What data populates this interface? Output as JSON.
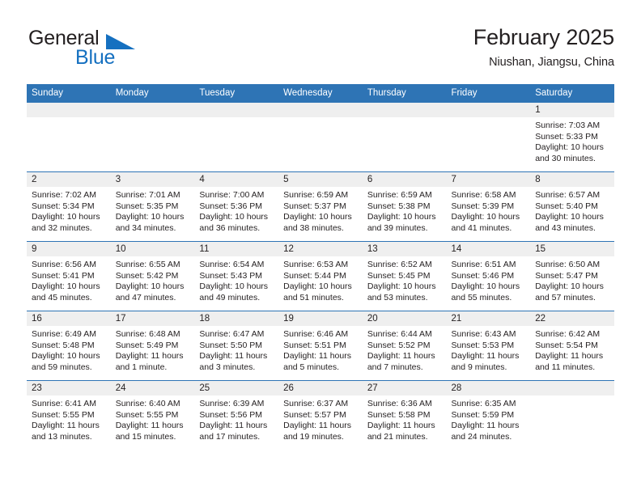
{
  "brand": {
    "name_part1": "General",
    "name_part2": "Blue",
    "triangle_color": "#1570c0",
    "text_color": "#231f20",
    "blue_color": "#1570c0"
  },
  "header": {
    "title": "February 2025",
    "subtitle": "Niushan, Jiangsu, China"
  },
  "theme": {
    "header_blue": "#2e74b5",
    "daynum_band": "#efefef",
    "text": "#231f20"
  },
  "calendar": {
    "weekdays": [
      "Sunday",
      "Monday",
      "Tuesday",
      "Wednesday",
      "Thursday",
      "Friday",
      "Saturday"
    ],
    "weeks": [
      [
        {
          "day": "",
          "sunrise": "",
          "sunset": "",
          "daylight": "",
          "empty": true
        },
        {
          "day": "",
          "sunrise": "",
          "sunset": "",
          "daylight": "",
          "empty": true
        },
        {
          "day": "",
          "sunrise": "",
          "sunset": "",
          "daylight": "",
          "empty": true
        },
        {
          "day": "",
          "sunrise": "",
          "sunset": "",
          "daylight": "",
          "empty": true
        },
        {
          "day": "",
          "sunrise": "",
          "sunset": "",
          "daylight": "",
          "empty": true
        },
        {
          "day": "",
          "sunrise": "",
          "sunset": "",
          "daylight": "",
          "empty": true
        },
        {
          "day": "1",
          "sunrise": "Sunrise: 7:03 AM",
          "sunset": "Sunset: 5:33 PM",
          "daylight": "Daylight: 10 hours and 30 minutes.",
          "empty": false
        }
      ],
      [
        {
          "day": "2",
          "sunrise": "Sunrise: 7:02 AM",
          "sunset": "Sunset: 5:34 PM",
          "daylight": "Daylight: 10 hours and 32 minutes.",
          "empty": false
        },
        {
          "day": "3",
          "sunrise": "Sunrise: 7:01 AM",
          "sunset": "Sunset: 5:35 PM",
          "daylight": "Daylight: 10 hours and 34 minutes.",
          "empty": false
        },
        {
          "day": "4",
          "sunrise": "Sunrise: 7:00 AM",
          "sunset": "Sunset: 5:36 PM",
          "daylight": "Daylight: 10 hours and 36 minutes.",
          "empty": false
        },
        {
          "day": "5",
          "sunrise": "Sunrise: 6:59 AM",
          "sunset": "Sunset: 5:37 PM",
          "daylight": "Daylight: 10 hours and 38 minutes.",
          "empty": false
        },
        {
          "day": "6",
          "sunrise": "Sunrise: 6:59 AM",
          "sunset": "Sunset: 5:38 PM",
          "daylight": "Daylight: 10 hours and 39 minutes.",
          "empty": false
        },
        {
          "day": "7",
          "sunrise": "Sunrise: 6:58 AM",
          "sunset": "Sunset: 5:39 PM",
          "daylight": "Daylight: 10 hours and 41 minutes.",
          "empty": false
        },
        {
          "day": "8",
          "sunrise": "Sunrise: 6:57 AM",
          "sunset": "Sunset: 5:40 PM",
          "daylight": "Daylight: 10 hours and 43 minutes.",
          "empty": false
        }
      ],
      [
        {
          "day": "9",
          "sunrise": "Sunrise: 6:56 AM",
          "sunset": "Sunset: 5:41 PM",
          "daylight": "Daylight: 10 hours and 45 minutes.",
          "empty": false
        },
        {
          "day": "10",
          "sunrise": "Sunrise: 6:55 AM",
          "sunset": "Sunset: 5:42 PM",
          "daylight": "Daylight: 10 hours and 47 minutes.",
          "empty": false
        },
        {
          "day": "11",
          "sunrise": "Sunrise: 6:54 AM",
          "sunset": "Sunset: 5:43 PM",
          "daylight": "Daylight: 10 hours and 49 minutes.",
          "empty": false
        },
        {
          "day": "12",
          "sunrise": "Sunrise: 6:53 AM",
          "sunset": "Sunset: 5:44 PM",
          "daylight": "Daylight: 10 hours and 51 minutes.",
          "empty": false
        },
        {
          "day": "13",
          "sunrise": "Sunrise: 6:52 AM",
          "sunset": "Sunset: 5:45 PM",
          "daylight": "Daylight: 10 hours and 53 minutes.",
          "empty": false
        },
        {
          "day": "14",
          "sunrise": "Sunrise: 6:51 AM",
          "sunset": "Sunset: 5:46 PM",
          "daylight": "Daylight: 10 hours and 55 minutes.",
          "empty": false
        },
        {
          "day": "15",
          "sunrise": "Sunrise: 6:50 AM",
          "sunset": "Sunset: 5:47 PM",
          "daylight": "Daylight: 10 hours and 57 minutes.",
          "empty": false
        }
      ],
      [
        {
          "day": "16",
          "sunrise": "Sunrise: 6:49 AM",
          "sunset": "Sunset: 5:48 PM",
          "daylight": "Daylight: 10 hours and 59 minutes.",
          "empty": false
        },
        {
          "day": "17",
          "sunrise": "Sunrise: 6:48 AM",
          "sunset": "Sunset: 5:49 PM",
          "daylight": "Daylight: 11 hours and 1 minute.",
          "empty": false
        },
        {
          "day": "18",
          "sunrise": "Sunrise: 6:47 AM",
          "sunset": "Sunset: 5:50 PM",
          "daylight": "Daylight: 11 hours and 3 minutes.",
          "empty": false
        },
        {
          "day": "19",
          "sunrise": "Sunrise: 6:46 AM",
          "sunset": "Sunset: 5:51 PM",
          "daylight": "Daylight: 11 hours and 5 minutes.",
          "empty": false
        },
        {
          "day": "20",
          "sunrise": "Sunrise: 6:44 AM",
          "sunset": "Sunset: 5:52 PM",
          "daylight": "Daylight: 11 hours and 7 minutes.",
          "empty": false
        },
        {
          "day": "21",
          "sunrise": "Sunrise: 6:43 AM",
          "sunset": "Sunset: 5:53 PM",
          "daylight": "Daylight: 11 hours and 9 minutes.",
          "empty": false
        },
        {
          "day": "22",
          "sunrise": "Sunrise: 6:42 AM",
          "sunset": "Sunset: 5:54 PM",
          "daylight": "Daylight: 11 hours and 11 minutes.",
          "empty": false
        }
      ],
      [
        {
          "day": "23",
          "sunrise": "Sunrise: 6:41 AM",
          "sunset": "Sunset: 5:55 PM",
          "daylight": "Daylight: 11 hours and 13 minutes.",
          "empty": false
        },
        {
          "day": "24",
          "sunrise": "Sunrise: 6:40 AM",
          "sunset": "Sunset: 5:55 PM",
          "daylight": "Daylight: 11 hours and 15 minutes.",
          "empty": false
        },
        {
          "day": "25",
          "sunrise": "Sunrise: 6:39 AM",
          "sunset": "Sunset: 5:56 PM",
          "daylight": "Daylight: 11 hours and 17 minutes.",
          "empty": false
        },
        {
          "day": "26",
          "sunrise": "Sunrise: 6:37 AM",
          "sunset": "Sunset: 5:57 PM",
          "daylight": "Daylight: 11 hours and 19 minutes.",
          "empty": false
        },
        {
          "day": "27",
          "sunrise": "Sunrise: 6:36 AM",
          "sunset": "Sunset: 5:58 PM",
          "daylight": "Daylight: 11 hours and 21 minutes.",
          "empty": false
        },
        {
          "day": "28",
          "sunrise": "Sunrise: 6:35 AM",
          "sunset": "Sunset: 5:59 PM",
          "daylight": "Daylight: 11 hours and 24 minutes.",
          "empty": false
        },
        {
          "day": "",
          "sunrise": "",
          "sunset": "",
          "daylight": "",
          "empty": true
        }
      ]
    ]
  }
}
